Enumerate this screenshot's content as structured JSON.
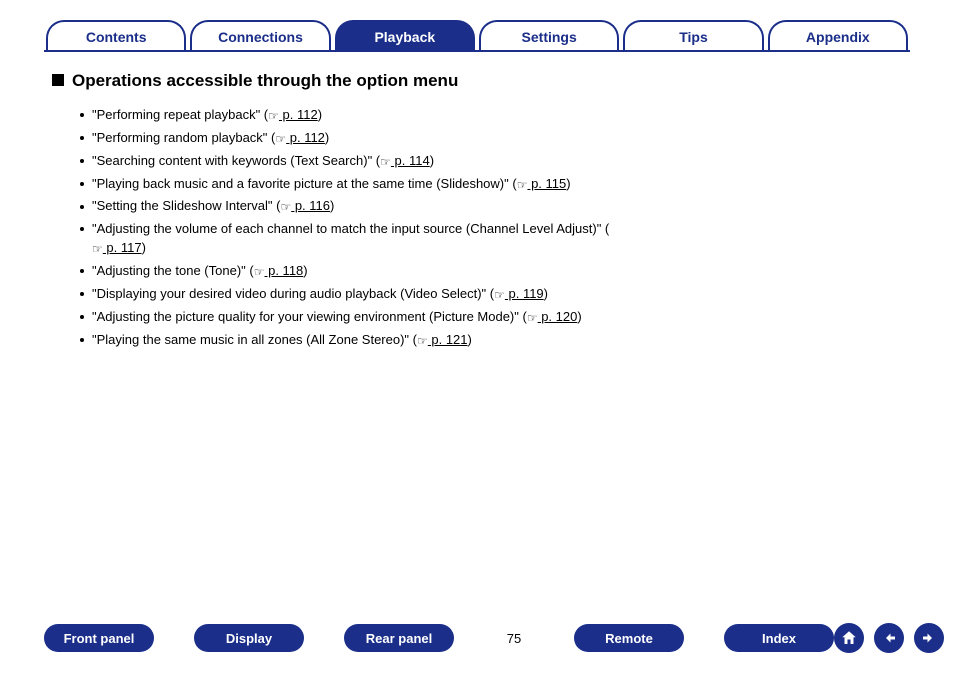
{
  "tabs": {
    "items": [
      {
        "label": "Contents"
      },
      {
        "label": "Connections"
      },
      {
        "label": "Playback"
      },
      {
        "label": "Settings"
      },
      {
        "label": "Tips"
      },
      {
        "label": "Appendix"
      }
    ],
    "activeIndex": 2
  },
  "heading": "Operations accessible through the option menu",
  "options": [
    {
      "pre": "\"Performing repeat playback\" (",
      "page": " p. 112",
      "post": ")"
    },
    {
      "pre": "\"Performing random playback\" (",
      "page": " p. 112",
      "post": ")"
    },
    {
      "pre": "\"Searching content with keywords (Text Search)\" (",
      "page": " p. 114",
      "post": ")"
    },
    {
      "pre": "\"Playing back music and a favorite picture at the same time (Slideshow)\" (",
      "page": " p. 115",
      "post": ")"
    },
    {
      "pre": "\"Setting the Slideshow Interval\" (",
      "page": " p. 116",
      "post": ")"
    },
    {
      "pre": "\"Adjusting the volume of each channel to match the input source (Channel Level Adjust)\" (",
      "page": " p. 117",
      "post": ")"
    },
    {
      "pre": "\"Adjusting the tone (Tone)\" (",
      "page": " p. 118",
      "post": ")"
    },
    {
      "pre": "\"Displaying your desired video during audio playback (Video Select)\" (",
      "page": " p. 119",
      "post": ")"
    },
    {
      "pre": "\"Adjusting the picture quality for your viewing environment (Picture Mode)\" (",
      "page": " p. 120",
      "post": ")"
    },
    {
      "pre": "\"Playing the same music in all zones (All Zone Stereo)\" (",
      "page": " p. 121",
      "post": ")"
    }
  ],
  "bottom": {
    "buttons": {
      "front_panel": "Front panel",
      "display": "Display",
      "rear_panel": "Rear panel",
      "remote": "Remote",
      "index": "Index"
    },
    "page_number": "75"
  },
  "icons": {
    "pointer_glyph": "☞"
  }
}
